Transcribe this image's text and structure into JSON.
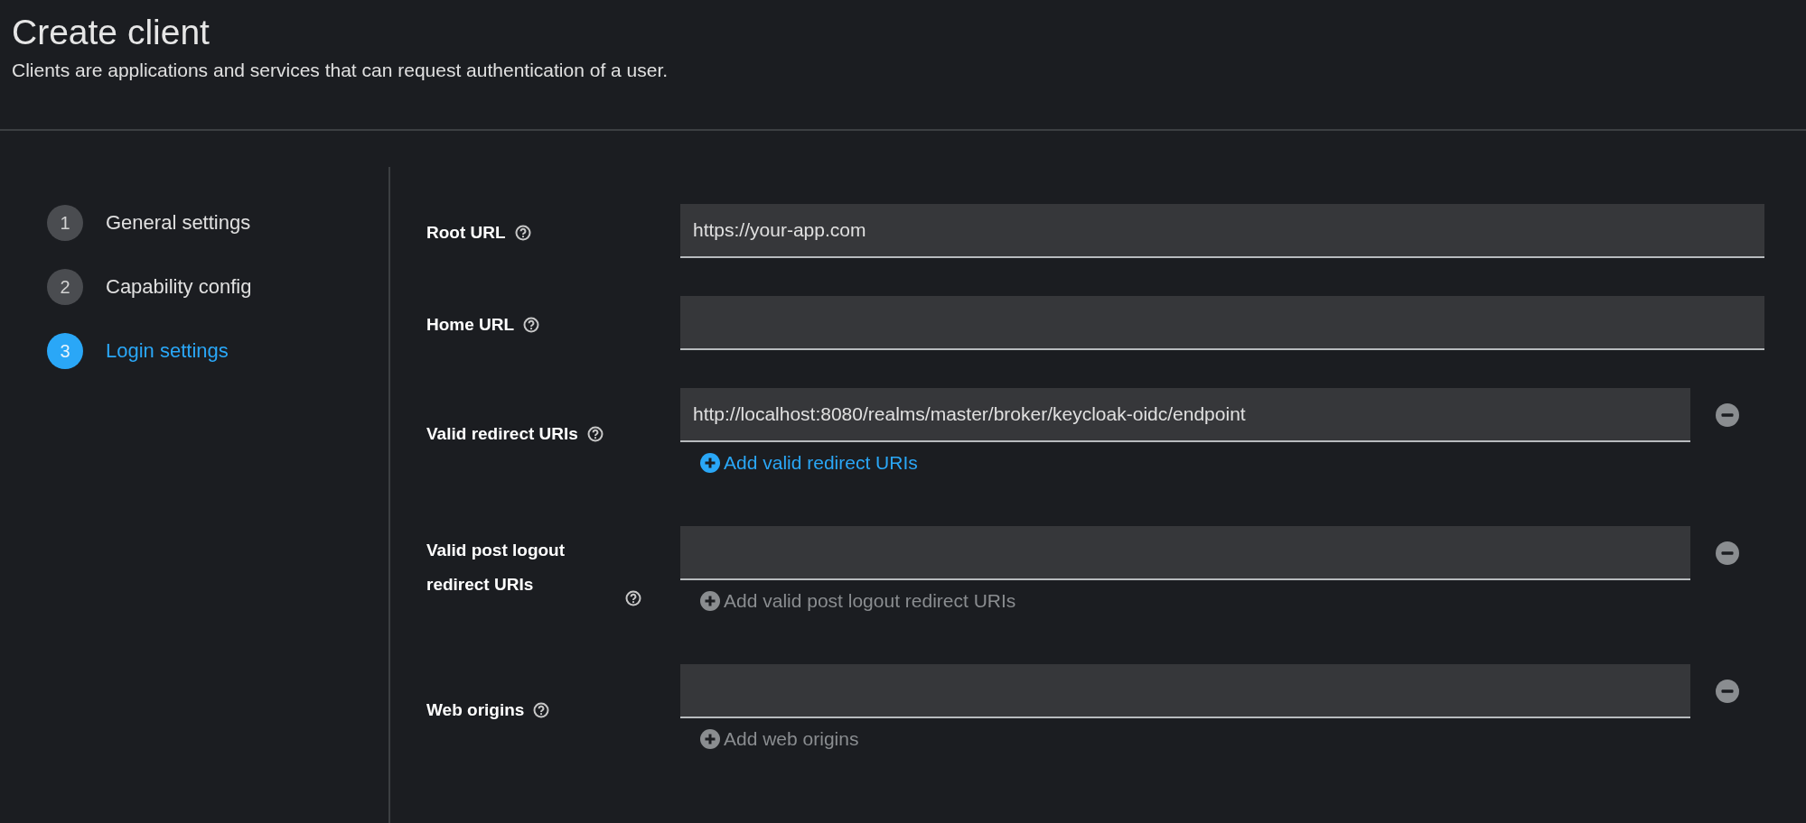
{
  "header": {
    "title": "Create client",
    "description": "Clients are applications and services that can request authentication of a user."
  },
  "steps": [
    {
      "number": "1",
      "label": "General settings",
      "selected": false
    },
    {
      "number": "2",
      "label": "Capability config",
      "selected": false
    },
    {
      "number": "3",
      "label": "Login settings",
      "selected": true
    }
  ],
  "fields": [
    {
      "kind": "single",
      "label": "Root URL",
      "value": "https://your-app.com"
    },
    {
      "kind": "single",
      "label": "Home URL"
    },
    {
      "kind": "multi",
      "label": "Valid redirect URIs",
      "value": "http://localhost:8080/realms/master/broker/keycloak-oidc/endpoint",
      "add_link": {
        "label": "Add valid redirect URIs",
        "disabled": false
      }
    },
    {
      "kind": "multi",
      "label": "Valid post logout redirect URIs",
      "add_link": {
        "label": "Add valid post logout redirect URIs",
        "disabled": true
      }
    },
    {
      "kind": "multi",
      "label": "Web origins",
      "add_link": {
        "label": "Add web origins",
        "disabled": true
      }
    }
  ]
}
